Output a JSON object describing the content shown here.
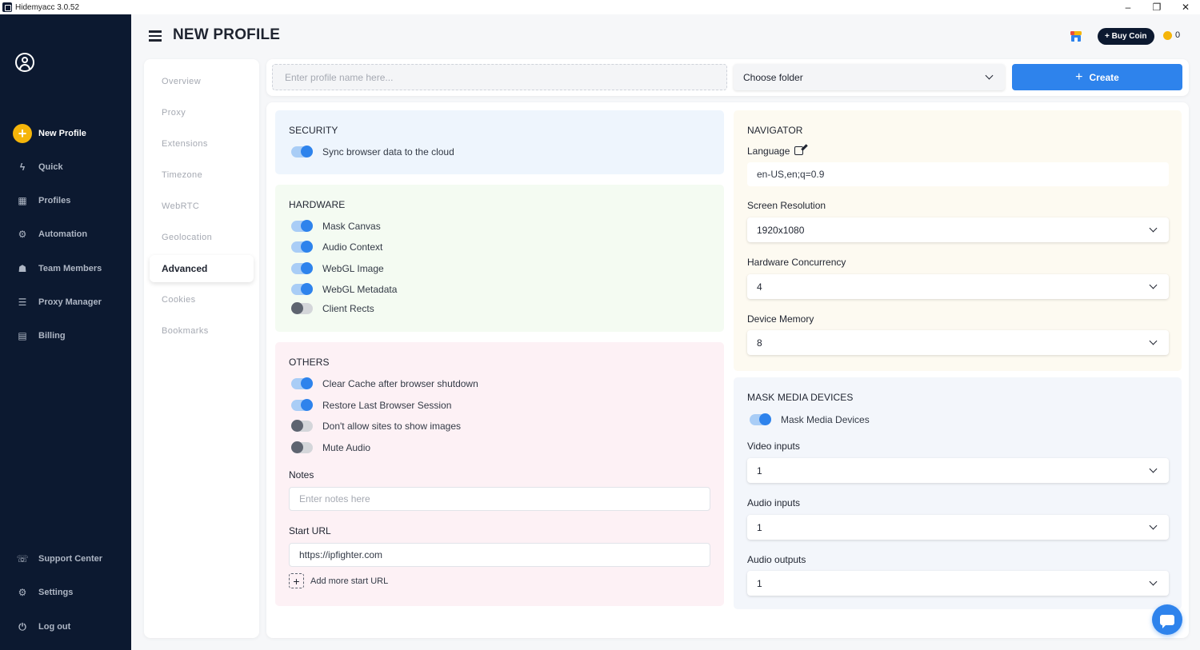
{
  "window": {
    "title": "Hidemyacc 3.0.52",
    "controls": [
      "–",
      "❐",
      "✕"
    ]
  },
  "sidebar": {
    "items": [
      {
        "label": "New Profile",
        "icon": "plus-icon",
        "glyph": "+"
      },
      {
        "label": "Quick",
        "icon": "bolt-icon",
        "glyph": "ϟ"
      },
      {
        "label": "Profiles",
        "icon": "grid-icon",
        "glyph": "▦"
      },
      {
        "label": "Automation",
        "icon": "robot-icon",
        "glyph": "⚙"
      },
      {
        "label": "Team Members",
        "icon": "team-icon",
        "glyph": "☗"
      },
      {
        "label": "Proxy Manager",
        "icon": "server-icon",
        "glyph": "☰"
      },
      {
        "label": "Billing",
        "icon": "receipt-icon",
        "glyph": "▤"
      }
    ],
    "bottom_items": [
      {
        "label": "Support Center",
        "icon": "support-icon",
        "glyph": "☏"
      },
      {
        "label": "Settings",
        "icon": "gear-icon",
        "glyph": "⚙"
      },
      {
        "label": "Log out",
        "icon": "logout-icon",
        "glyph": "⏻"
      }
    ]
  },
  "header": {
    "title": "NEW PROFILE",
    "buy_coin": "+ Buy Coin",
    "coin_count": "0"
  },
  "subnav": {
    "items": [
      "Overview",
      "Proxy",
      "Extensions",
      "Timezone",
      "WebRTC",
      "Geolocation",
      "Advanced",
      "Cookies",
      "Bookmarks"
    ],
    "active": "Advanced"
  },
  "topbar": {
    "name_placeholder": "Enter profile name here...",
    "folder_value": "Choose folder",
    "create_label": "Create"
  },
  "security": {
    "title": "SECURITY",
    "toggles": [
      {
        "label": "Sync browser data to the cloud",
        "on": true
      }
    ]
  },
  "hardware": {
    "title": "HARDWARE",
    "toggles": [
      {
        "label": "Mask Canvas",
        "on": true
      },
      {
        "label": "Audio Context",
        "on": true
      },
      {
        "label": "WebGL Image",
        "on": true
      },
      {
        "label": "WebGL Metadata",
        "on": true
      },
      {
        "label": "Client Rects",
        "on": false
      }
    ]
  },
  "others": {
    "title": "OTHERS",
    "toggles": [
      {
        "label": "Clear Cache after browser shutdown",
        "on": true
      },
      {
        "label": "Restore Last Browser Session",
        "on": true
      },
      {
        "label": "Don't allow sites to show images",
        "on": false
      },
      {
        "label": "Mute Audio",
        "on": false
      }
    ],
    "notes_label": "Notes",
    "notes_placeholder": "Enter notes here",
    "start_url_label": "Start URL",
    "start_url_value": "https://ipfighter.com",
    "add_url_label": "Add more start URL"
  },
  "navigator": {
    "title": "NAVIGATOR",
    "language_label": "Language",
    "language_value": "en-US,en;q=0.9",
    "screen_resolution_label": "Screen Resolution",
    "screen_resolution_value": "1920x1080",
    "hardware_concurrency_label": "Hardware Concurrency",
    "hardware_concurrency_value": "4",
    "device_memory_label": "Device Memory",
    "device_memory_value": "8"
  },
  "media": {
    "title": "MASK MEDIA DEVICES",
    "toggle_label": "Mask Media Devices",
    "toggle_on": true,
    "video_inputs_label": "Video inputs",
    "video_inputs_value": "1",
    "audio_inputs_label": "Audio inputs",
    "audio_inputs_value": "1",
    "audio_outputs_label": "Audio outputs",
    "audio_outputs_value": "1"
  },
  "colors": {
    "sidebar_bg": "#0c1930",
    "accent": "#2e83ec",
    "coin": "#f5b50a",
    "security_bg": "#eef5fd",
    "hardware_bg": "#f4fbf2",
    "others_bg": "#fdf1f5",
    "navigator_bg": "#fdfaf1",
    "media_bg": "#f3f6fb"
  }
}
